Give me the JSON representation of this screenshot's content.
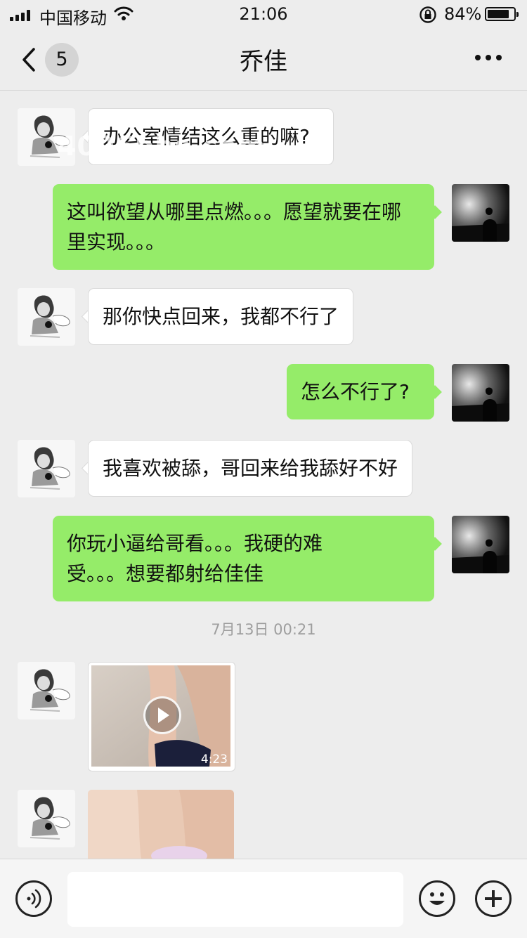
{
  "status_bar": {
    "carrier": "中国移动",
    "time": "21:06",
    "battery_text": "84%",
    "battery_level": 0.84
  },
  "nav": {
    "unread_count": "5",
    "title": "乔佳"
  },
  "watermark": "4096bbs.com",
  "messages": [
    {
      "side": "left",
      "text": "办公室情结这么重的嘛?"
    },
    {
      "side": "right",
      "text": "这叫欲望从哪里点燃。。。愿望就要在哪里实现。。。"
    },
    {
      "side": "left",
      "text": "那你快点回来，我都不行了"
    },
    {
      "side": "right",
      "text": "怎么不行了?"
    },
    {
      "side": "left",
      "text": "我喜欢被舔，哥回来给我舔好不好"
    },
    {
      "side": "right",
      "text": "你玩小逼给哥看。。。我硬的难受。。。想要都射给佳佳"
    }
  ],
  "timestamp": "7月13日 00:21",
  "video": {
    "duration": "4:23"
  },
  "icons": {
    "back": "chevron-left-icon",
    "more": "more-icon",
    "voice": "voice-icon",
    "emoji": "emoji-icon",
    "plus": "plus-icon"
  },
  "colors": {
    "background": "#ededed",
    "self_bubble": "#95ec69",
    "other_bubble": "#ffffff"
  }
}
